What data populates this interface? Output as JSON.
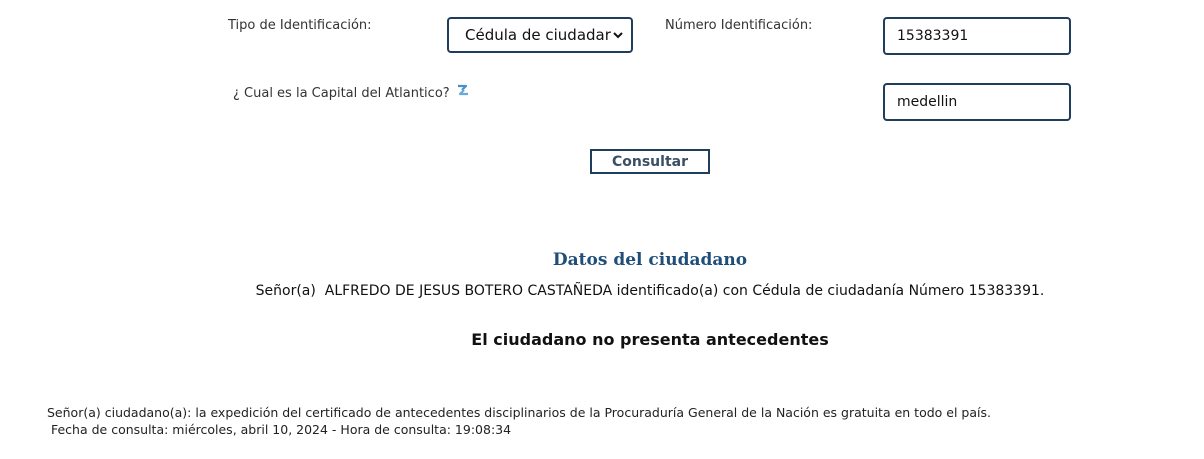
{
  "form": {
    "tipo_label": "Tipo de Identificación:",
    "tipo_selected": "Cédula de ciudadar",
    "numero_label": "Número Identificación:",
    "numero_value": "15383391",
    "pregunta_label": "¿ Cual es la Capital del Atlantico?",
    "respuesta_value": "medellin",
    "submit_label": "Consultar",
    "refresh_icon": "refresh-icon",
    "select_chevron_icon": "chevron-down-icon"
  },
  "result": {
    "title": "Datos del ciudadano",
    "citizen_line": "Señor(a)  ALFREDO DE JESUS BOTERO CASTAÑEDA identificado(a) con Cédula de ciudadanía Número 15383391.",
    "status": "El ciudadano no presenta antecedentes"
  },
  "footer": {
    "notice": "Señor(a) ciudadano(a): la expedición del certificado de antecedentes disciplinarios de la Procuraduría General de la Nación es gratuita en todo el país.",
    "fecha": " Fecha de consulta: miércoles, abril 10, 2024 - Hora de consulta: 19:08:34"
  },
  "colors": {
    "border": "#1f3d5c",
    "title": "#1f4e79",
    "refresh_icon": "#4a90c8"
  }
}
